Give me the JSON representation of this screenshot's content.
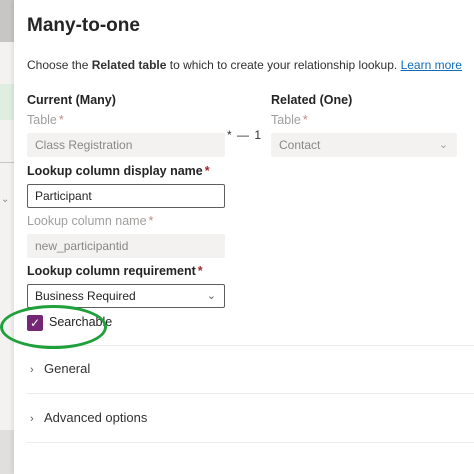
{
  "panel": {
    "title": "Many-to-one",
    "subtitle_prefix": "Choose the ",
    "subtitle_bold": "Related table",
    "subtitle_suffix": " to which to create your relationship lookup.",
    "learn_more": "Learn more"
  },
  "current": {
    "heading": "Current (Many)",
    "table_label": "Table",
    "table_value": "Class Registration"
  },
  "related": {
    "heading": "Related (One)",
    "table_label": "Table",
    "table_value": "Contact"
  },
  "connector": "* — 1",
  "required_marker": "*",
  "lookup": {
    "display_name_label": "Lookup column display name",
    "display_name_value": "Participant",
    "name_label": "Lookup column name",
    "name_value": "new_participantid",
    "requirement_label": "Lookup column requirement",
    "requirement_value": "Business Required"
  },
  "searchable": {
    "label": "Searchable",
    "checked": true
  },
  "sections": {
    "general": "General",
    "advanced": "Advanced options"
  },
  "colors": {
    "accent": "#742774",
    "link": "#0f6cbd",
    "highlight": "#20a03a"
  }
}
